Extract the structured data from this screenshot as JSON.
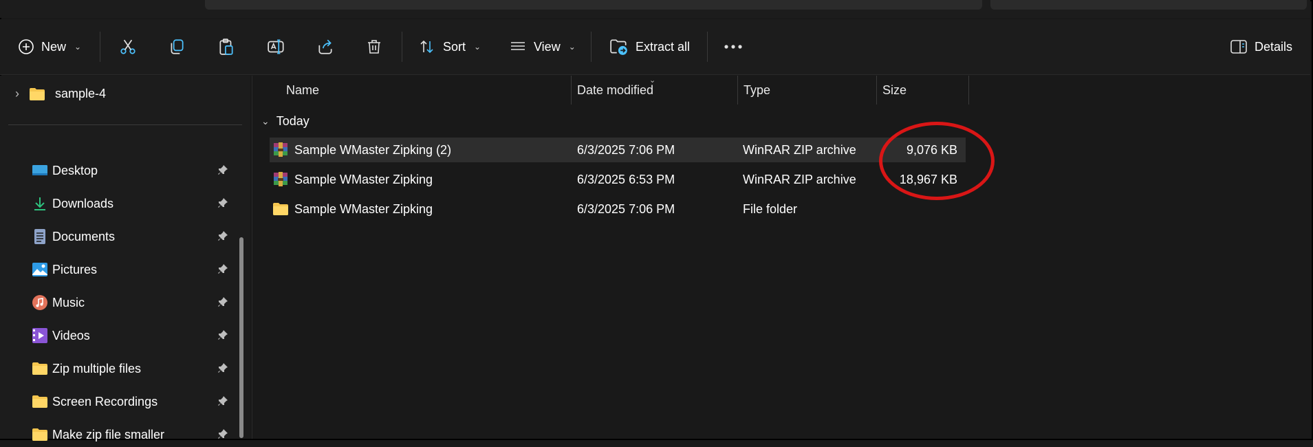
{
  "toolbar": {
    "new_label": "New",
    "sort_label": "Sort",
    "view_label": "View",
    "extract_label": "Extract all",
    "details_label": "Details"
  },
  "nav": {
    "top_item": "sample-4",
    "items": [
      {
        "label": "Desktop",
        "icon": "desktop-icon"
      },
      {
        "label": "Downloads",
        "icon": "download-arrow-icon"
      },
      {
        "label": "Documents",
        "icon": "document-icon"
      },
      {
        "label": "Pictures",
        "icon": "picture-icon"
      },
      {
        "label": "Music",
        "icon": "music-icon"
      },
      {
        "label": "Videos",
        "icon": "video-icon"
      },
      {
        "label": "Zip multiple files",
        "icon": "folder-icon"
      },
      {
        "label": "Screen Recordings",
        "icon": "folder-icon"
      },
      {
        "label": "Make zip file smaller",
        "icon": "folder-icon"
      }
    ]
  },
  "columns": {
    "name": "Name",
    "date": "Date modified",
    "type": "Type",
    "size": "Size"
  },
  "group": {
    "label": "Today"
  },
  "files": [
    {
      "name": "Sample WMaster Zipking (2)",
      "date": "6/3/2025 7:06 PM",
      "type": "WinRAR ZIP archive",
      "size": "9,076 KB",
      "icon": "winrar-archive-icon"
    },
    {
      "name": "Sample WMaster Zipking",
      "date": "6/3/2025 6:53 PM",
      "type": "WinRAR ZIP archive",
      "size": "18,967 KB",
      "icon": "winrar-archive-icon"
    },
    {
      "name": "Sample WMaster Zipking",
      "date": "6/3/2025 7:06 PM",
      "type": "File folder",
      "size": "",
      "icon": "folder-icon"
    }
  ],
  "colors": {
    "background": "#191919",
    "selected_row": "#2e2e2e",
    "highlight_circle": "#d91616",
    "folder": "#f5c64f",
    "accent": "#4cc2ff"
  }
}
